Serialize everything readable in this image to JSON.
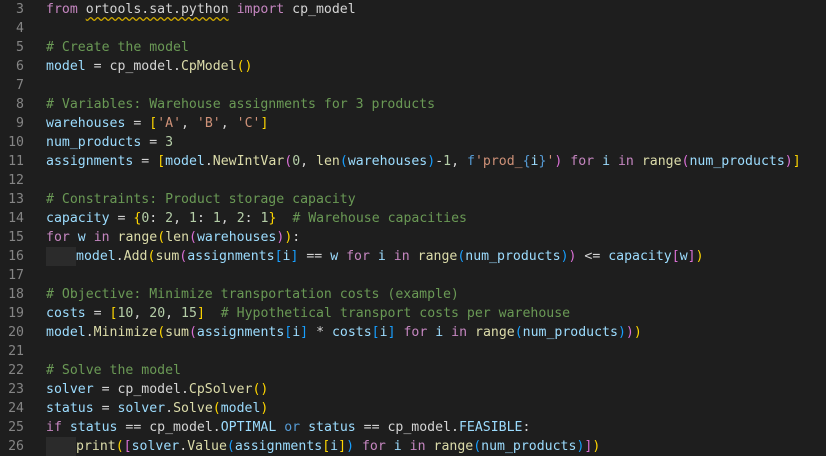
{
  "editor": {
    "lines": [
      {
        "n": "3",
        "tokens": [
          [
            "kw",
            "from"
          ],
          [
            "plain",
            " "
          ],
          [
            "sq",
            "ortools.sat.python"
          ],
          [
            "plain",
            " "
          ],
          [
            "kw",
            "import"
          ],
          [
            "plain",
            " cp_model"
          ]
        ]
      },
      {
        "n": "4",
        "tokens": []
      },
      {
        "n": "5",
        "tokens": [
          [
            "cm",
            "# Create the model"
          ]
        ]
      },
      {
        "n": "6",
        "tokens": [
          [
            "var",
            "model"
          ],
          [
            "plain",
            " = cp_model."
          ],
          [
            "fn",
            "CpModel"
          ],
          [
            "p1",
            "()"
          ]
        ]
      },
      {
        "n": "7",
        "tokens": []
      },
      {
        "n": "8",
        "tokens": [
          [
            "cm",
            "# Variables: Warehouse assignments for 3 products"
          ]
        ]
      },
      {
        "n": "9",
        "tokens": [
          [
            "var",
            "warehouses"
          ],
          [
            "plain",
            " = "
          ],
          [
            "p1",
            "["
          ],
          [
            "str",
            "'A'"
          ],
          [
            "plain",
            ", "
          ],
          [
            "str",
            "'B'"
          ],
          [
            "plain",
            ", "
          ],
          [
            "str",
            "'C'"
          ],
          [
            "p1",
            "]"
          ]
        ]
      },
      {
        "n": "10",
        "tokens": [
          [
            "var",
            "num_products"
          ],
          [
            "plain",
            " = "
          ],
          [
            "num",
            "3"
          ]
        ]
      },
      {
        "n": "11",
        "tokens": [
          [
            "var",
            "assignments"
          ],
          [
            "plain",
            " = "
          ],
          [
            "p1",
            "["
          ],
          [
            "var",
            "model"
          ],
          [
            "plain",
            "."
          ],
          [
            "fn",
            "NewIntVar"
          ],
          [
            "p2",
            "("
          ],
          [
            "num",
            "0"
          ],
          [
            "plain",
            ", "
          ],
          [
            "fn",
            "len"
          ],
          [
            "p3",
            "("
          ],
          [
            "var",
            "warehouses"
          ],
          [
            "p3",
            ")"
          ],
          [
            "plain",
            "-"
          ],
          [
            "num",
            "1"
          ],
          [
            "plain",
            ", "
          ],
          [
            "kw2",
            "f"
          ],
          [
            "str",
            "'prod_"
          ],
          [
            "kw2",
            "{"
          ],
          [
            "var",
            "i"
          ],
          [
            "kw2",
            "}"
          ],
          [
            "str",
            "'"
          ],
          [
            "p2",
            ")"
          ],
          [
            "plain",
            " "
          ],
          [
            "kw",
            "for"
          ],
          [
            "plain",
            " "
          ],
          [
            "var",
            "i"
          ],
          [
            "plain",
            " "
          ],
          [
            "kw",
            "in"
          ],
          [
            "plain",
            " "
          ],
          [
            "fn",
            "range"
          ],
          [
            "p2",
            "("
          ],
          [
            "var",
            "num_products"
          ],
          [
            "p2",
            ")"
          ],
          [
            "p1",
            "]"
          ]
        ]
      },
      {
        "n": "12",
        "tokens": []
      },
      {
        "n": "13",
        "tokens": [
          [
            "cm",
            "# Constraints: Product storage capacity"
          ]
        ]
      },
      {
        "n": "14",
        "tokens": [
          [
            "var",
            "capacity"
          ],
          [
            "plain",
            " = "
          ],
          [
            "p1",
            "{"
          ],
          [
            "num",
            "0"
          ],
          [
            "plain",
            ": "
          ],
          [
            "num",
            "2"
          ],
          [
            "plain",
            ", "
          ],
          [
            "num",
            "1"
          ],
          [
            "plain",
            ": "
          ],
          [
            "num",
            "1"
          ],
          [
            "plain",
            ", "
          ],
          [
            "num",
            "2"
          ],
          [
            "plain",
            ": "
          ],
          [
            "num",
            "1"
          ],
          [
            "p1",
            "}"
          ],
          [
            "plain",
            "  "
          ],
          [
            "cm",
            "# Warehouse capacities"
          ]
        ]
      },
      {
        "n": "15",
        "tokens": [
          [
            "kw",
            "for"
          ],
          [
            "plain",
            " "
          ],
          [
            "var",
            "w"
          ],
          [
            "plain",
            " "
          ],
          [
            "kw",
            "in"
          ],
          [
            "plain",
            " "
          ],
          [
            "fn",
            "range"
          ],
          [
            "p1",
            "("
          ],
          [
            "fn",
            "len"
          ],
          [
            "p2",
            "("
          ],
          [
            "var",
            "warehouses"
          ],
          [
            "p2",
            ")"
          ],
          [
            "p1",
            ")"
          ],
          [
            "plain",
            ":"
          ]
        ]
      },
      {
        "n": "16",
        "indent": true,
        "tokens": [
          [
            "var",
            "model"
          ],
          [
            "plain",
            "."
          ],
          [
            "fn",
            "Add"
          ],
          [
            "p1",
            "("
          ],
          [
            "fn",
            "sum"
          ],
          [
            "p2",
            "("
          ],
          [
            "var",
            "assignments"
          ],
          [
            "p3",
            "["
          ],
          [
            "var",
            "i"
          ],
          [
            "p3",
            "]"
          ],
          [
            "plain",
            " == "
          ],
          [
            "var",
            "w"
          ],
          [
            "plain",
            " "
          ],
          [
            "kw",
            "for"
          ],
          [
            "plain",
            " "
          ],
          [
            "var",
            "i"
          ],
          [
            "plain",
            " "
          ],
          [
            "kw",
            "in"
          ],
          [
            "plain",
            " "
          ],
          [
            "fn",
            "range"
          ],
          [
            "p3",
            "("
          ],
          [
            "var",
            "num_products"
          ],
          [
            "p3",
            ")"
          ],
          [
            "p2",
            ")"
          ],
          [
            "plain",
            " <= "
          ],
          [
            "var",
            "capacity"
          ],
          [
            "p2",
            "["
          ],
          [
            "var",
            "w"
          ],
          [
            "p2",
            "]"
          ],
          [
            "p1",
            ")"
          ]
        ]
      },
      {
        "n": "17",
        "tokens": []
      },
      {
        "n": "18",
        "tokens": [
          [
            "cm",
            "# Objective: Minimize transportation costs (example)"
          ]
        ]
      },
      {
        "n": "19",
        "tokens": [
          [
            "var",
            "costs"
          ],
          [
            "plain",
            " = "
          ],
          [
            "p1",
            "["
          ],
          [
            "num",
            "10"
          ],
          [
            "plain",
            ", "
          ],
          [
            "num",
            "20"
          ],
          [
            "plain",
            ", "
          ],
          [
            "num",
            "15"
          ],
          [
            "p1",
            "]"
          ],
          [
            "plain",
            "  "
          ],
          [
            "cm",
            "# Hypothetical transport costs per warehouse"
          ]
        ]
      },
      {
        "n": "20",
        "tokens": [
          [
            "var",
            "model"
          ],
          [
            "plain",
            "."
          ],
          [
            "fn",
            "Minimize"
          ],
          [
            "p1",
            "("
          ],
          [
            "fn",
            "sum"
          ],
          [
            "p2",
            "("
          ],
          [
            "var",
            "assignments"
          ],
          [
            "p3",
            "["
          ],
          [
            "var",
            "i"
          ],
          [
            "p3",
            "]"
          ],
          [
            "plain",
            " * "
          ],
          [
            "var",
            "costs"
          ],
          [
            "p3",
            "["
          ],
          [
            "var",
            "i"
          ],
          [
            "p3",
            "]"
          ],
          [
            "plain",
            " "
          ],
          [
            "kw",
            "for"
          ],
          [
            "plain",
            " "
          ],
          [
            "var",
            "i"
          ],
          [
            "plain",
            " "
          ],
          [
            "kw",
            "in"
          ],
          [
            "plain",
            " "
          ],
          [
            "fn",
            "range"
          ],
          [
            "p3",
            "("
          ],
          [
            "var",
            "num_products"
          ],
          [
            "p3",
            ")"
          ],
          [
            "p2",
            ")"
          ],
          [
            "p1",
            ")"
          ]
        ]
      },
      {
        "n": "21",
        "tokens": []
      },
      {
        "n": "22",
        "tokens": [
          [
            "cm",
            "# Solve the model"
          ]
        ]
      },
      {
        "n": "23",
        "tokens": [
          [
            "var",
            "solver"
          ],
          [
            "plain",
            " = cp_model."
          ],
          [
            "fn",
            "CpSolver"
          ],
          [
            "p1",
            "()"
          ]
        ]
      },
      {
        "n": "24",
        "tokens": [
          [
            "var",
            "status"
          ],
          [
            "plain",
            " = "
          ],
          [
            "var",
            "solver"
          ],
          [
            "plain",
            "."
          ],
          [
            "fn",
            "Solve"
          ],
          [
            "p1",
            "("
          ],
          [
            "var",
            "model"
          ],
          [
            "p1",
            ")"
          ]
        ]
      },
      {
        "n": "25",
        "tokens": [
          [
            "kw",
            "if"
          ],
          [
            "plain",
            " "
          ],
          [
            "var",
            "status"
          ],
          [
            "plain",
            " == cp_model."
          ],
          [
            "var",
            "OPTIMAL"
          ],
          [
            "plain",
            " "
          ],
          [
            "kw2",
            "or"
          ],
          [
            "plain",
            " "
          ],
          [
            "var",
            "status"
          ],
          [
            "plain",
            " == cp_model."
          ],
          [
            "var",
            "FEASIBLE"
          ],
          [
            "plain",
            ":"
          ]
        ]
      },
      {
        "n": "26",
        "indent": true,
        "tokens": [
          [
            "fn",
            "print"
          ],
          [
            "p1",
            "("
          ],
          [
            "p2",
            "["
          ],
          [
            "var",
            "solver"
          ],
          [
            "plain",
            "."
          ],
          [
            "fn",
            "Value"
          ],
          [
            "p3",
            "("
          ],
          [
            "var",
            "assignments"
          ],
          [
            "p1",
            "["
          ],
          [
            "var",
            "i"
          ],
          [
            "p1",
            "]"
          ],
          [
            "p3",
            ")"
          ],
          [
            "plain",
            " "
          ],
          [
            "kw",
            "for"
          ],
          [
            "plain",
            " "
          ],
          [
            "var",
            "i"
          ],
          [
            "plain",
            " "
          ],
          [
            "kw",
            "in"
          ],
          [
            "plain",
            " "
          ],
          [
            "fn",
            "range"
          ],
          [
            "p3",
            "("
          ],
          [
            "var",
            "num_products"
          ],
          [
            "p3",
            ")"
          ],
          [
            "p2",
            "]"
          ],
          [
            "p1",
            ")"
          ]
        ]
      }
    ]
  }
}
